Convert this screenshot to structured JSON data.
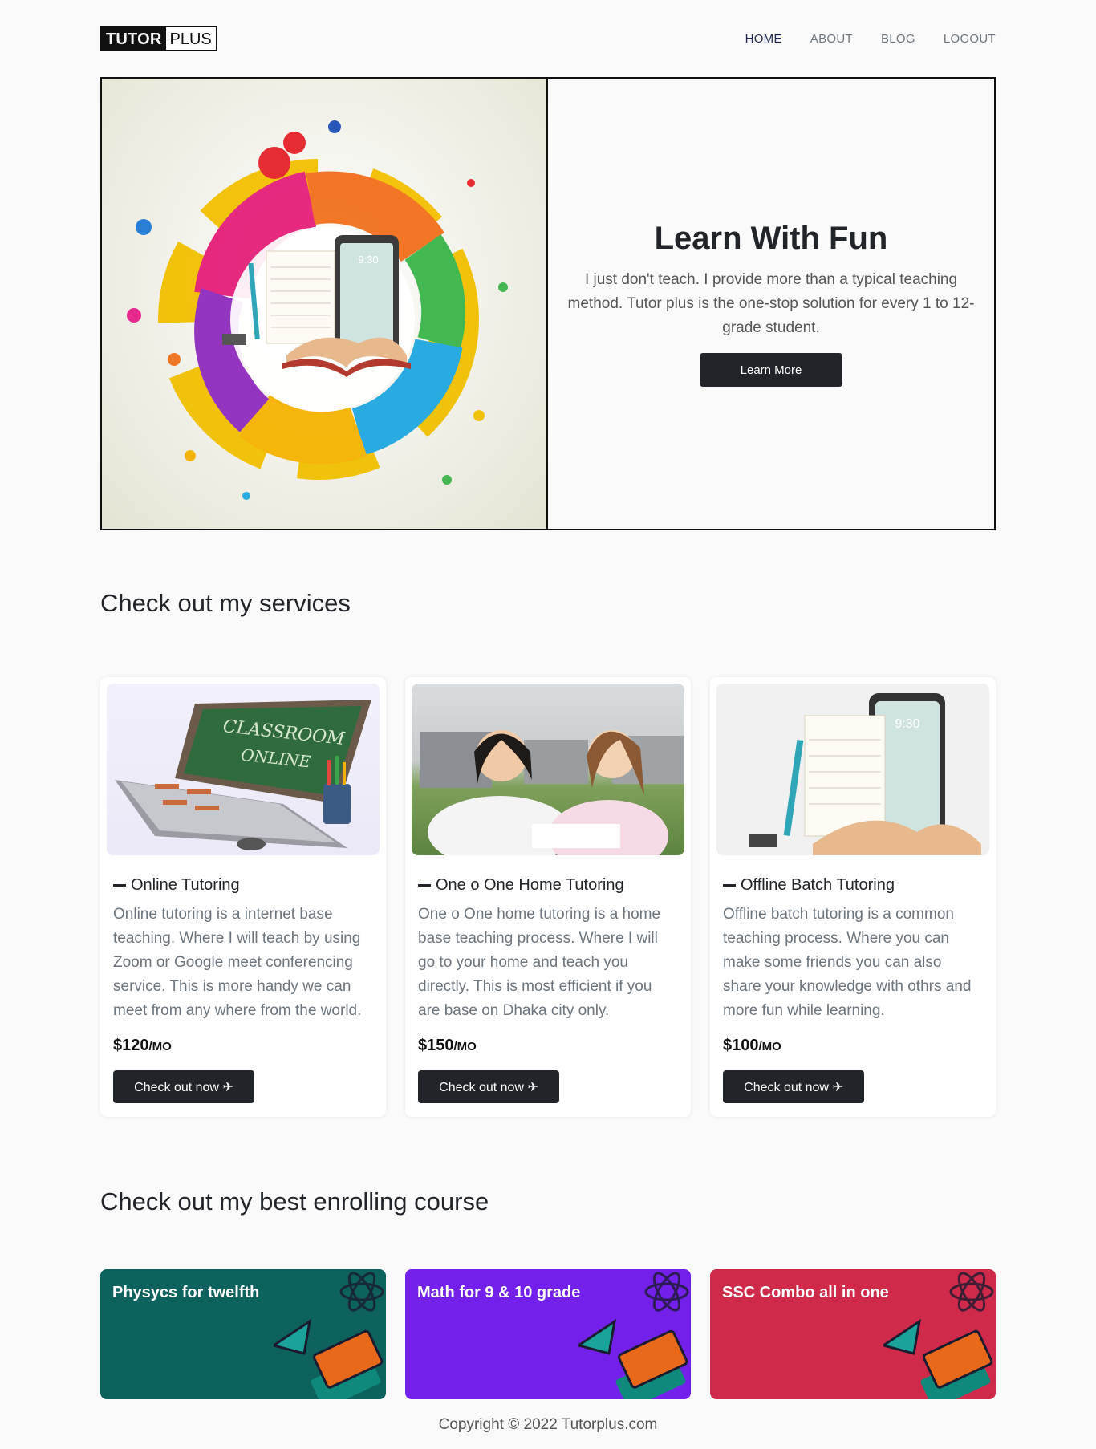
{
  "nav": {
    "logo_part1": "TUTOR",
    "logo_part2": "PLUS",
    "links": [
      "HOME",
      "ABOUT",
      "BLOG",
      "LOGOUT"
    ]
  },
  "hero": {
    "title": "Learn With Fun",
    "text": "I just don't teach. I provide more than a typical teaching method. Tutor plus is the one-stop solution for every 1 to 12-grade student.",
    "button": "Learn More",
    "phone_time": "9:30"
  },
  "services": {
    "heading": "Check out my services",
    "items": [
      {
        "title": "Online Tutoring",
        "desc": "Online tutoring is a internet base teaching. Where I will teach by using Zoom or Google meet conferencing service. This is more handy we can meet from any where from the world.",
        "price": "$120",
        "unit": "/MO",
        "button": "Check out now",
        "image_text_1": "CLASSROOM",
        "image_text_2": "ONLINE"
      },
      {
        "title": "One o One Home Tutoring",
        "desc": "One o One home tutoring is a home base teaching process. Where I will go to your home and teach you directly. This is most efficient if you are base on Dhaka city only.",
        "price": "$150",
        "unit": "/MO",
        "button": "Check out now"
      },
      {
        "title": "Offline Batch Tutoring",
        "desc": "Offline batch tutoring is a common teaching process. Where you can make some friends you can also share your knowledge with othrs and more fun while learning.",
        "price": "$100",
        "unit": "/MO",
        "button": "Check out now",
        "image_text_1": "9:30"
      }
    ]
  },
  "courses": {
    "heading": "Check out my best enrolling course",
    "items": [
      {
        "title": "Physycs for twelfth",
        "color": "#0d625e"
      },
      {
        "title": "Math for 9 & 10 grade",
        "color": "#7320ea"
      },
      {
        "title": "SSC Combo all in one",
        "color": "#d02a4a"
      }
    ]
  },
  "footer": {
    "text": "Copyright © 2022 Tutorplus.com"
  }
}
